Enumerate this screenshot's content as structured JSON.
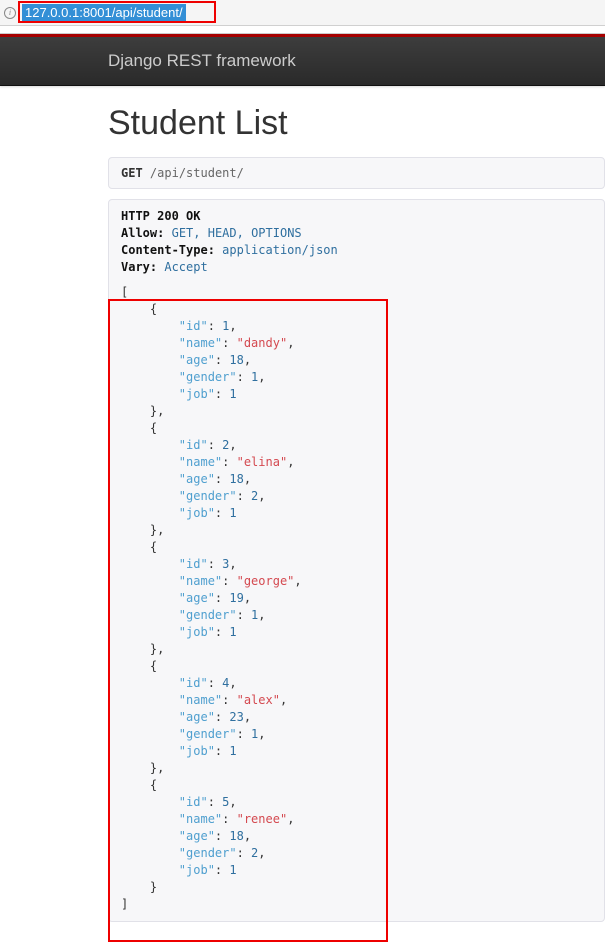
{
  "browser": {
    "url": "127.0.0.1:8001/api/student/"
  },
  "navbar": {
    "brand": "Django REST framework"
  },
  "page": {
    "title": "Student List"
  },
  "request": {
    "method": "GET",
    "path": "/api/student/"
  },
  "response": {
    "status_line": "HTTP 200 OK",
    "headers": {
      "allow_label": "Allow:",
      "allow_value": "GET, HEAD, OPTIONS",
      "ctype_label": "Content-Type:",
      "ctype_value": "application/json",
      "vary_label": "Vary:",
      "vary_value": "Accept"
    },
    "body": [
      {
        "id": 1,
        "name": "dandy",
        "age": 18,
        "gender": 1,
        "job": 1
      },
      {
        "id": 2,
        "name": "elina",
        "age": 18,
        "gender": 2,
        "job": 1
      },
      {
        "id": 3,
        "name": "george",
        "age": 19,
        "gender": 1,
        "job": 1
      },
      {
        "id": 4,
        "name": "alex",
        "age": 23,
        "gender": 1,
        "job": 1
      },
      {
        "id": 5,
        "name": "renee",
        "age": 18,
        "gender": 2,
        "job": 1
      }
    ]
  }
}
